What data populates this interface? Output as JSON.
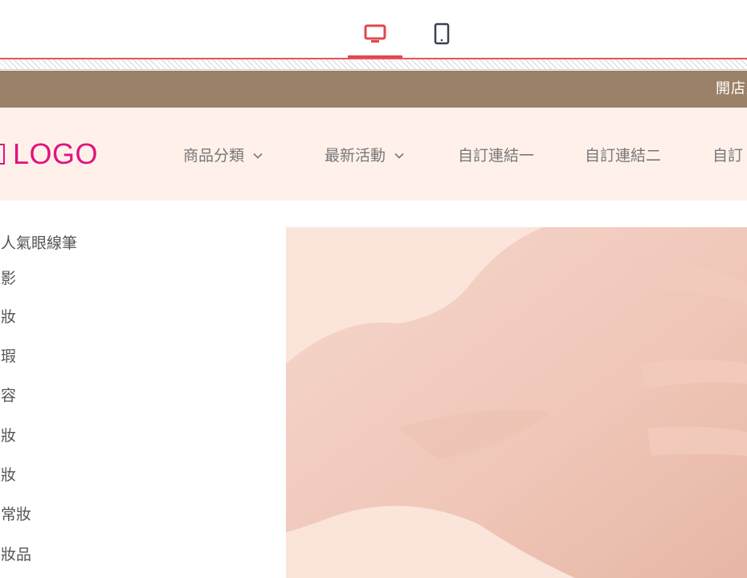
{
  "device_switcher": {
    "desktop_icon": "desktop-icon",
    "mobile_icon": "mobile-icon",
    "active": "desktop",
    "accent_color": "#e0474c"
  },
  "announcement": {
    "text": "開店慶",
    "bg_color": "#9b8168"
  },
  "header": {
    "bg_color": "#fff1ea",
    "logo_text": "LOGO",
    "logo_color": "#e0147d",
    "nav": [
      {
        "label": "商品分類",
        "has_dropdown": true
      },
      {
        "label": "最新活動",
        "has_dropdown": true
      },
      {
        "label": "自訂連結一",
        "has_dropdown": false
      },
      {
        "label": "自訂連結二",
        "has_dropdown": false
      },
      {
        "label": "自訂",
        "has_dropdown": false
      }
    ]
  },
  "categories": [
    "超人氣眼線筆",
    "眼影",
    "底妝",
    "遮瑕",
    "修容",
    "眉妝",
    "頰妝",
    "日常妝",
    "定妝品"
  ],
  "hero": {
    "image_subject": "hand-on-pink-background"
  }
}
